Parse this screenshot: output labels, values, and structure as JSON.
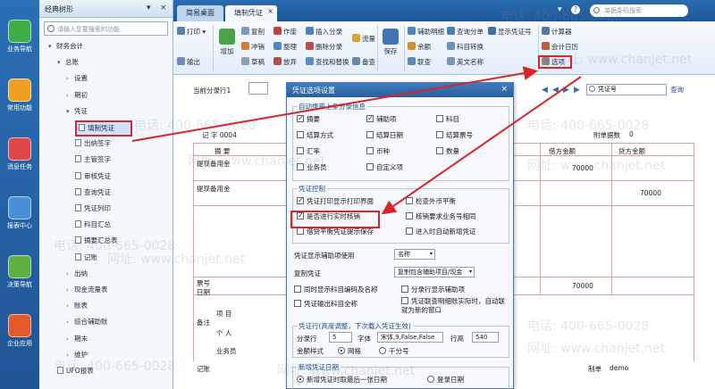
{
  "rail": [
    {
      "name": "rail-item-business-nav",
      "label": "业务导航",
      "color": "#3fae49"
    },
    {
      "name": "rail-item-common",
      "label": "常用功能",
      "color": "#f0a020"
    },
    {
      "name": "rail-item-message",
      "label": "消息任务",
      "color": "#e04848"
    },
    {
      "name": "rail-item-report",
      "label": "报表中心",
      "color": "#4a90d9"
    },
    {
      "name": "rail-item-decision",
      "label": "决策导航",
      "color": "#5cb040"
    },
    {
      "name": "rail-item-app-center",
      "label": "企业应用",
      "color": "#e25a2a"
    }
  ],
  "nav": {
    "title": "经典树形",
    "pin": "▾",
    "close": "×",
    "search_placeholder": "请输入您要搜索的功能",
    "tree": [
      {
        "label": "财务会计",
        "arrow": "▾",
        "indent": 0,
        "doc": false
      },
      {
        "label": "总账",
        "arrow": "▾",
        "indent": 1,
        "doc": false
      },
      {
        "label": "设置",
        "arrow": "›",
        "indent": 2,
        "doc": false
      },
      {
        "label": "期初",
        "arrow": "›",
        "indent": 2,
        "doc": false
      },
      {
        "label": "凭证",
        "arrow": "▾",
        "indent": 2,
        "doc": false
      },
      {
        "label": "填制凭证",
        "arrow": "",
        "indent": 3,
        "doc": true,
        "selected": true
      },
      {
        "label": "出纳签字",
        "arrow": "",
        "indent": 3,
        "doc": true
      },
      {
        "label": "主管签字",
        "arrow": "",
        "indent": 3,
        "doc": true
      },
      {
        "label": "审核凭证",
        "arrow": "",
        "indent": 3,
        "doc": true
      },
      {
        "label": "查询凭证",
        "arrow": "",
        "indent": 3,
        "doc": true
      },
      {
        "label": "凭证列印",
        "arrow": "",
        "indent": 3,
        "doc": true
      },
      {
        "label": "科目汇总",
        "arrow": "",
        "indent": 3,
        "doc": true
      },
      {
        "label": "摘要汇总表",
        "arrow": "",
        "indent": 3,
        "doc": true
      },
      {
        "label": "记账",
        "arrow": "",
        "indent": 3,
        "doc": true
      },
      {
        "label": "出纳",
        "arrow": "›",
        "indent": 2,
        "doc": false
      },
      {
        "label": "现金流量表",
        "arrow": "›",
        "indent": 2,
        "doc": false
      },
      {
        "label": "账表",
        "arrow": "›",
        "indent": 2,
        "doc": false
      },
      {
        "label": "综合辅助账",
        "arrow": "›",
        "indent": 2,
        "doc": false
      },
      {
        "label": "期末",
        "arrow": "›",
        "indent": 2,
        "doc": false
      },
      {
        "label": "维护",
        "arrow": "›",
        "indent": 2,
        "doc": false
      },
      {
        "label": "UFO报表",
        "arrow": "",
        "indent": 1,
        "doc": true
      }
    ]
  },
  "tabs": [
    {
      "label": "简易桌面",
      "active": false
    },
    {
      "label": "填制凭证",
      "active": true
    }
  ],
  "tab_close": "×",
  "top_search_placeholder": "单据条码搜索",
  "top_icons": {
    "menu": "▾",
    "help": "?",
    "account": "●"
  },
  "ribbon": {
    "print": "打印",
    "print_dd": "▾",
    "export": "输出",
    "add": "增加",
    "copy": "复制",
    "void": "作废",
    "insert_entry": "插入分录",
    "flow": "流量",
    "save": "保存",
    "aux_detail": "辅助明细",
    "query_entry": "查询分单",
    "show_voucher": "显示凭证号",
    "calculator": "计算器",
    "rush": "冲销",
    "tidy": "整理",
    "delete_entry": "删除分录",
    "balance": "余额",
    "subject_convert": "科目转换",
    "calendar": "会计日历",
    "draft": "草稿",
    "drop": "放弃",
    "ins": "查找和替换",
    "backup": "备查",
    "review": "联查",
    "options": "选项",
    "english_name": "英文名称"
  },
  "voucher": {
    "current_entry": "当前分录行1",
    "voucher_no": "记  字 0004",
    "summary": "摘  要",
    "row1": "提现备用金",
    "row2": "提现备用金",
    "attach": "附单据数",
    "attach_val": "0",
    "debit": "借方金额",
    "credit": "贷方金额",
    "amount1": "70000",
    "amount2": "70000",
    "amount3": "70000",
    "ticket_no": "票号",
    "date": "日期",
    "remark": "备注",
    "project": "项 目",
    "person": "个 人",
    "business_person": "业务员",
    "bookkeeper": "记账",
    "maker": "制单",
    "maker_name": "demo",
    "search_label": "凭证号",
    "nav_arrows": [
      "◀",
      "◀",
      "▶",
      "▶"
    ],
    "query_btn": "查询"
  },
  "dialog": {
    "title": "凭证选项设置",
    "close": "×",
    "g1_title": "自动携带上条分录信息",
    "g1": [
      {
        "label": "摘要",
        "on": true
      },
      {
        "label": "辅助项",
        "on": true
      },
      {
        "label": "科目",
        "on": false
      },
      {
        "label": "结算方式",
        "on": false
      },
      {
        "label": "结算日期",
        "on": false
      },
      {
        "label": "结算票号",
        "on": false
      },
      {
        "label": "汇率",
        "on": false
      },
      {
        "label": "币种",
        "on": false
      },
      {
        "label": "数量",
        "on": false
      },
      {
        "label": "业务员",
        "on": false
      },
      {
        "label": "自定义项",
        "on": false
      }
    ],
    "g2_title": "凭证控制",
    "g2": [
      {
        "label": "凭证打印显示打印界面",
        "on": true
      },
      {
        "label": "检查外币平衡",
        "on": false
      },
      {
        "label": "是否进行实时核销",
        "on": true
      },
      {
        "label": "核销要求业务号相同",
        "on": false
      },
      {
        "label": "借贷平衡凭证提示保存",
        "on": false
      },
      {
        "label": "进入时自动新增凭证",
        "on": false
      }
    ],
    "show_mode_label": "凭证显示辅助项使用",
    "show_mode_val": "名称",
    "copy_voucher_label": "复制凭证",
    "copy_voucher_val": "复制包含辅助项目/现金",
    "g3": [
      {
        "label": "同时显示科目编码及名称",
        "on": false
      },
      {
        "label": "分录行显示辅助项",
        "on": false
      },
      {
        "label": "凭证输出科目全称",
        "on": false
      },
      {
        "label": "凭证联查明细账实际时，自动联就为新的窗口",
        "on": false
      }
    ],
    "g4_title": "凭证行(高度调整，下次载入凭证生效)",
    "row_label": "分录行",
    "row_val": "5",
    "font_label": "字体",
    "font_val": "宋体,9,False,False",
    "height_label": "行高",
    "height_val": "540",
    "amount_format_label": "金额样式",
    "amount_grid": "网格",
    "amount_sep": "千分号",
    "g5_title": "新增凭证日期",
    "new_date_a": "新增凭证时取最后一张日期",
    "new_date_b": "登录日期"
  },
  "watermarks": [
    "电话: 400-665-0028",
    "网址: www.chanjet.net"
  ],
  "colors": {
    "rail": "#1f5595",
    "accent": "#2a6cb0",
    "annotation": "#d9252a"
  }
}
